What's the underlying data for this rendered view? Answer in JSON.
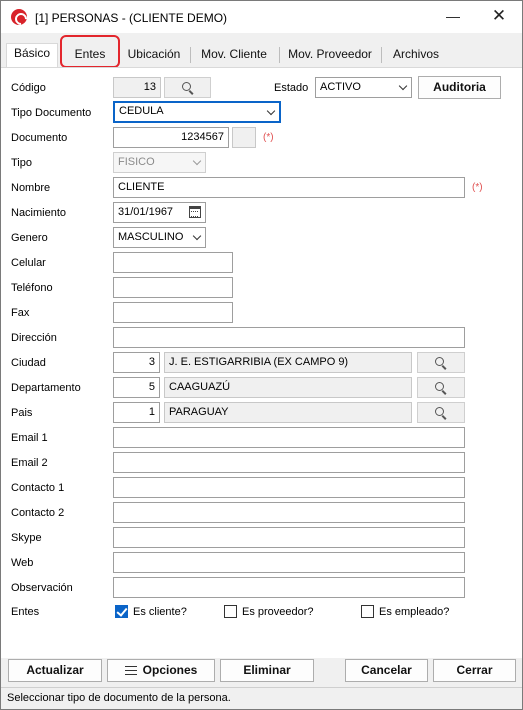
{
  "window": {
    "title": "[1] PERSONAS - (CLIENTE DEMO)",
    "min_glyph": "—",
    "close_glyph": "✕"
  },
  "tabs": [
    {
      "label": "Básico"
    },
    {
      "label": "Entes"
    },
    {
      "label": "Ubicación"
    },
    {
      "label": "Mov. Cliente"
    },
    {
      "label": "Mov. Proveedor"
    },
    {
      "label": "Archivos"
    }
  ],
  "form": {
    "codigo": {
      "label": "Código",
      "value": "13"
    },
    "estado": {
      "label": "Estado",
      "value": "ACTIVO"
    },
    "auditoria": {
      "label": "Auditoria"
    },
    "tipo_documento": {
      "label": "Tipo Documento",
      "value": "CEDULA"
    },
    "documento": {
      "label": "Documento",
      "value": "1234567",
      "required": "(*)"
    },
    "tipo": {
      "label": "Tipo",
      "value": "FISICO"
    },
    "nombre": {
      "label": "Nombre",
      "value": "CLIENTE",
      "required": "(*)"
    },
    "nacimiento": {
      "label": "Nacimiento",
      "value": "31/01/1967"
    },
    "genero": {
      "label": "Genero",
      "value": "MASCULINO"
    },
    "celular": {
      "label": "Celular",
      "value": ""
    },
    "telefono": {
      "label": "Teléfono",
      "value": ""
    },
    "fax": {
      "label": "Fax",
      "value": ""
    },
    "direccion": {
      "label": "Dirección",
      "value": ""
    },
    "ciudad": {
      "label": "Ciudad",
      "code": "3",
      "name": "J. E. ESTIGARRIBIA (EX CAMPO 9)"
    },
    "departamento": {
      "label": "Departamento",
      "code": "5",
      "name": "CAAGUAZÚ"
    },
    "pais": {
      "label": "Pais",
      "code": "1",
      "name": "PARAGUAY"
    },
    "email1": {
      "label": "Email 1",
      "value": ""
    },
    "email2": {
      "label": "Email 2",
      "value": ""
    },
    "contacto1": {
      "label": "Contacto 1",
      "value": ""
    },
    "contacto2": {
      "label": "Contacto 2",
      "value": ""
    },
    "skype": {
      "label": "Skype",
      "value": ""
    },
    "web": {
      "label": "Web",
      "value": ""
    },
    "observacion": {
      "label": "Observación",
      "value": ""
    },
    "entes": {
      "label": "Entes",
      "es_cliente": {
        "label": "Es cliente?",
        "checked": true
      },
      "es_proveedor": {
        "label": "Es proveedor?",
        "checked": false
      },
      "es_empleado": {
        "label": "Es empleado?",
        "checked": false
      }
    }
  },
  "buttons": {
    "actualizar": {
      "label": "Actualizar"
    },
    "opciones": {
      "label": "Opciones"
    },
    "eliminar": {
      "label": "Eliminar"
    },
    "cancelar": {
      "label": "Cancelar"
    },
    "cerrar": {
      "label": "Cerrar"
    }
  },
  "status": {
    "text": "Seleccionar tipo de documento de la persona."
  },
  "colors": {
    "accent": "#0a64c8",
    "highlight": "#e3262d",
    "required": "#e05050"
  }
}
